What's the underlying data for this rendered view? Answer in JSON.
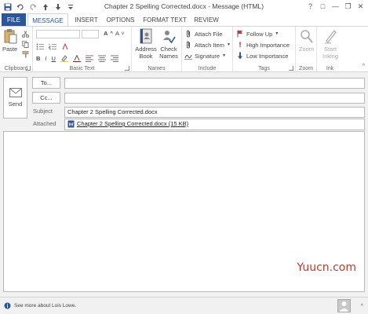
{
  "window": {
    "title": "Chapter 2 Spelling Corrected.docx - Message (HTML)",
    "controls": [
      "?",
      "□",
      "—",
      "❐",
      "✕"
    ]
  },
  "tabs": [
    {
      "label": "FILE"
    },
    {
      "label": "MESSAGE"
    },
    {
      "label": "INSERT"
    },
    {
      "label": "OPTIONS"
    },
    {
      "label": "FORMAT TEXT"
    },
    {
      "label": "REVIEW"
    }
  ],
  "ribbon": {
    "clipboard": {
      "label": "Clipboard",
      "paste": "Paste"
    },
    "basic_text": {
      "label": "Basic Text",
      "bold": "B",
      "italic": "I",
      "underline": "U",
      "grow": "A",
      "shrink": "A"
    },
    "names": {
      "label": "Names",
      "address_book": "Address Book",
      "check_names": "Check Names"
    },
    "include": {
      "label": "Include",
      "attach_file": "Attach File",
      "attach_item": "Attach Item",
      "signature": "Signature"
    },
    "tags": {
      "label": "Tags",
      "follow_up": "Follow Up",
      "high_importance": "High Importance",
      "low_importance": "Low Importance"
    },
    "zoom": {
      "label": "Zoom",
      "zoom_btn": "Zoom"
    },
    "ink": {
      "label": "Ink",
      "start_inking": "Start Inking"
    }
  },
  "compose": {
    "send": "Send",
    "to_label": "To...",
    "cc_label": "Cc...",
    "subject_label": "Subject",
    "subject_value": "Chapter 2 Spelling Corrected.docx",
    "attached_label": "Attached",
    "attachment": "Chapter 2 Spelling Corrected.docx (15 KB)"
  },
  "watermark": "Yuucn.com",
  "people_bar": {
    "text": "See more about Lois Lowe.",
    "toggle": "^"
  },
  "colors": {
    "file_tab": "#2b579a",
    "active_tab_text": "#2b579a",
    "flag_red": "#d13438",
    "importance_red": "#c00000",
    "low_blue": "#2b579a",
    "watermark": "#c0392b"
  }
}
